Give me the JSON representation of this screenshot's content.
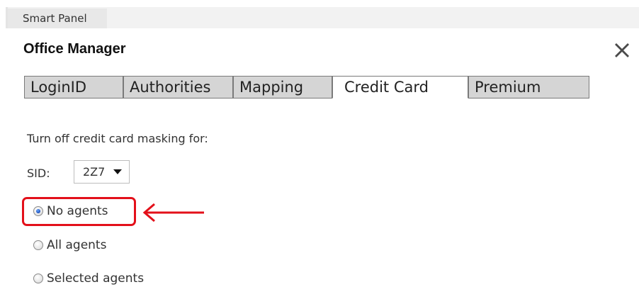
{
  "header": {
    "tab_label": "Smart Panel"
  },
  "dialog": {
    "title": "Office Manager",
    "close_icon": "close-icon"
  },
  "tabs": [
    {
      "label": "LoginID",
      "active": false
    },
    {
      "label": "Authorities",
      "active": false
    },
    {
      "label": "Mapping",
      "active": false
    },
    {
      "label": "Credit Card",
      "active": true
    },
    {
      "label": "Premium",
      "active": false
    }
  ],
  "content": {
    "prompt": "Turn off credit card masking for:",
    "sid_label": "SID:",
    "sid_value": "2Z7",
    "options": [
      {
        "label": "No agents",
        "checked": true
      },
      {
        "label": "All agents",
        "checked": false
      },
      {
        "label": "Selected agents",
        "checked": false
      }
    ]
  },
  "annotation": {
    "color": "#e3101a"
  }
}
